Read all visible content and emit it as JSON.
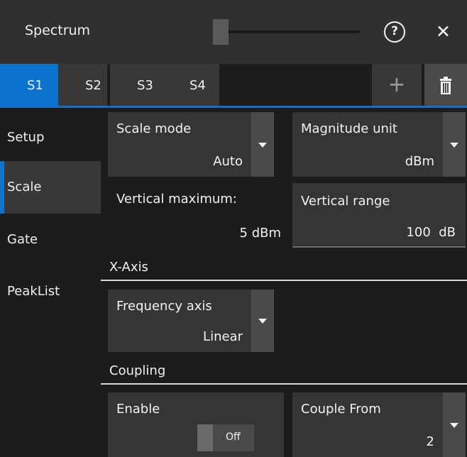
{
  "dialog": {
    "title": "Spectrum"
  },
  "tabs": [
    "S1",
    "S2",
    "S3",
    "S4"
  ],
  "toolbar": {
    "add_symbol": "+"
  },
  "sidebar": {
    "items": [
      "Setup",
      "Scale",
      "Gate",
      "PeakList"
    ],
    "active": "Scale"
  },
  "scale": {
    "scale_mode": {
      "label": "Scale mode",
      "value": "Auto"
    },
    "magnitude_unit": {
      "label": "Magnitude unit",
      "value": "dBm"
    },
    "vertical_maximum": {
      "label": "Vertical maximum:",
      "value": "5 dBm"
    },
    "vertical_range": {
      "label": "Vertical range",
      "value": "100  dB"
    }
  },
  "x_axis": {
    "title": "X-Axis",
    "frequency_axis": {
      "label": "Frequency axis",
      "value": "Linear"
    }
  },
  "coupling": {
    "title": "Coupling",
    "enable": {
      "label": "Enable",
      "state": "Off"
    },
    "couple_from": {
      "label": "Couple From",
      "value": "2"
    }
  },
  "colors": {
    "accent": "#0a73ce",
    "panel": "#353535",
    "background": "#1c1c1c"
  }
}
